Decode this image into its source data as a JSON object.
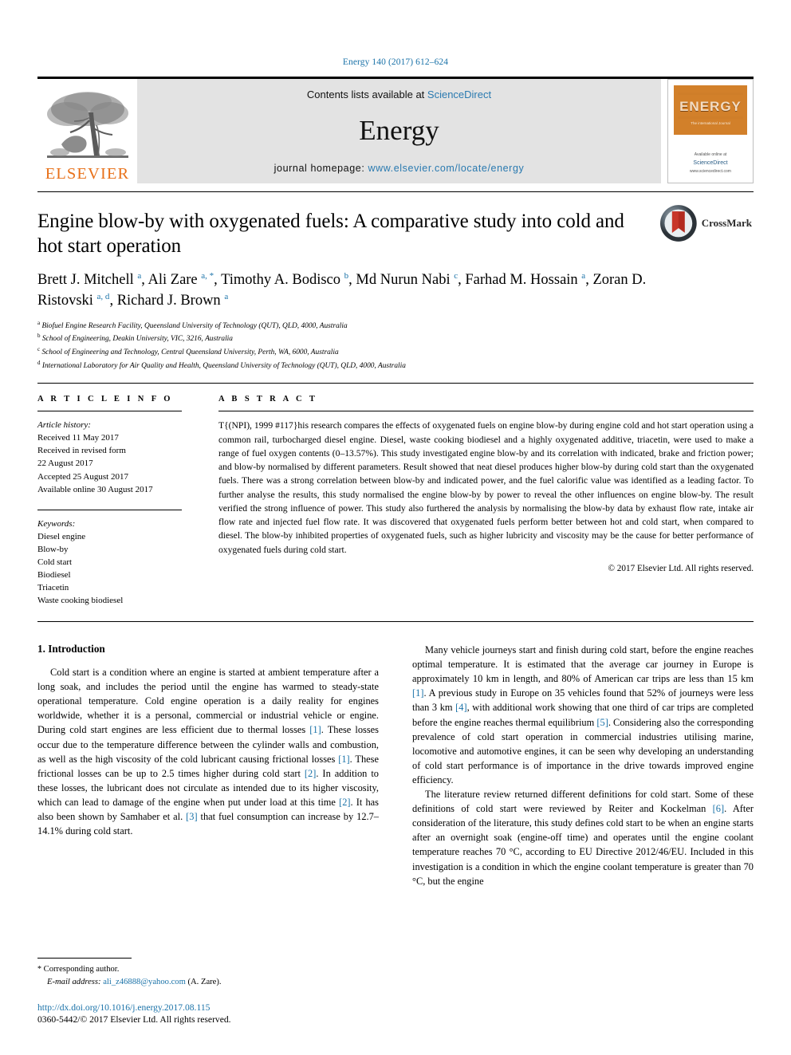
{
  "running_head": "Energy 140 (2017) 612–624",
  "masthead": {
    "publisher_name": "ELSEVIER",
    "contents_prefix": "Contents lists available at ",
    "contents_link": "ScienceDirect",
    "journal_name": "Energy",
    "homepage_label": "journal homepage: ",
    "homepage_url": "www.elsevier.com/locate/energy",
    "cover": {
      "title": "ENERGY",
      "subtitle": "The international Journal",
      "footer_line1": "Available online at",
      "footer_line2": "ScienceDirect",
      "footer_line3": "www.sciencedirect.com"
    }
  },
  "article": {
    "title": "Engine blow-by with oxygenated fuels: A comparative study into cold and hot start operation",
    "crossmark_label": "CrossMark",
    "authors": [
      {
        "name": "Brett J. Mitchell",
        "marks": "a"
      },
      {
        "name": "Ali Zare",
        "marks": "a, *"
      },
      {
        "name": "Timothy A. Bodisco",
        "marks": "b"
      },
      {
        "name": "Md Nurun Nabi",
        "marks": "c"
      },
      {
        "name": "Farhad M. Hossain",
        "marks": "a"
      },
      {
        "name": "Zoran D. Ristovski",
        "marks": "a, d"
      },
      {
        "name": "Richard J. Brown",
        "marks": "a"
      }
    ],
    "affiliations": [
      {
        "mark": "a",
        "text": "Biofuel Engine Research Facility, Queensland University of Technology (QUT), QLD, 4000, Australia"
      },
      {
        "mark": "b",
        "text": "School of Engineering, Deakin University, VIC, 3216, Australia"
      },
      {
        "mark": "c",
        "text": "School of Engineering and Technology, Central Queensland University, Perth, WA, 6000, Australia"
      },
      {
        "mark": "d",
        "text": "International Laboratory for Air Quality and Health, Queensland University of Technology (QUT), QLD, 4000, Australia"
      }
    ]
  },
  "article_info": {
    "heading": "A R T I C L E  I N F O",
    "history_label": "Article history:",
    "history": [
      "Received 11 May 2017",
      "Received in revised form",
      "22 August 2017",
      "Accepted 25 August 2017",
      "Available online 30 August 2017"
    ],
    "keywords_label": "Keywords:",
    "keywords": [
      "Diesel engine",
      "Blow-by",
      "Cold start",
      "Biodiesel",
      "Triacetin",
      "Waste cooking biodiesel"
    ]
  },
  "abstract": {
    "heading": "A B S T R A C T",
    "text": "T{(NPI), 1999 #117}his research compares the effects of oxygenated fuels on engine blow-by during engine cold and hot start operation using a common rail, turbocharged diesel engine. Diesel, waste cooking biodiesel and a highly oxygenated additive, triacetin, were used to make a range of fuel oxygen contents (0–13.57%). This study investigated engine blow-by and its correlation with indicated, brake and friction power; and blow-by normalised by different parameters. Result showed that neat diesel produces higher blow-by during cold start than the oxygenated fuels. There was a strong correlation between blow-by and indicated power, and the fuel calorific value was identified as a leading factor. To further analyse the results, this study normalised the engine blow-by by power to reveal the other influences on engine blow-by. The result verified the strong influence of power. This study also furthered the analysis by normalising the blow-by data by exhaust flow rate, intake air flow rate and injected fuel flow rate. It was discovered that oxygenated fuels perform better between hot and cold start, when compared to diesel. The blow-by inhibited properties of oxygenated fuels, such as higher lubricity and viscosity may be the cause for better performance of oxygenated fuels during cold start.",
    "copyright": "© 2017 Elsevier Ltd. All rights reserved."
  },
  "body": {
    "section_heading": "1. Introduction",
    "left_paragraphs": [
      "Cold start is a condition where an engine is started at ambient temperature after a long soak, and includes the period until the engine has warmed to steady-state operational temperature. Cold engine operation is a daily reality for engines worldwide, whether it is a personal, commercial or industrial vehicle or engine. During cold start engines are less efficient due to thermal losses [1]. These losses occur due to the temperature difference between the cylinder walls and combustion, as well as the high viscosity of the cold lubricant causing frictional losses [1]. These frictional losses can be up to 2.5 times higher during cold start [2]. In addition to these losses, the lubricant does not circulate as intended due to its higher viscosity, which can lead to damage of the engine when put under load at this time [2]. It has also been shown by Samhaber et al. [3] that fuel consumption can increase by 12.7–14.1% during cold start."
    ],
    "right_paragraphs": [
      "Many vehicle journeys start and finish during cold start, before the engine reaches optimal temperature. It is estimated that the average car journey in Europe is approximately 10 km in length, and 80% of American car trips are less than 15 km [1]. A previous study in Europe on 35 vehicles found that 52% of journeys were less than 3 km [4], with additional work showing that one third of car trips are completed before the engine reaches thermal equilibrium [5]. Considering also the corresponding prevalence of cold start operation in commercial industries utilising marine, locomotive and automotive engines, it can be seen why developing an understanding of cold start performance is of importance in the drive towards improved engine efficiency.",
      "The literature review returned different definitions for cold start. Some of these definitions of cold start were reviewed by Reiter and Kockelman [6]. After consideration of the literature, this study defines cold start to be when an engine starts after an overnight soak (engine-off time) and operates until the engine coolant temperature reaches 70 °C, according to EU Directive 2012/46/EU. Included in this investigation is a condition in which the engine coolant temperature is greater than 70 °C, but the engine"
    ]
  },
  "footer": {
    "corresponding_star": "*",
    "corresponding_label": "Corresponding author.",
    "email_label": "E-mail address:",
    "email": "ali_z46888@yahoo.com",
    "email_owner": "(A. Zare).",
    "doi": "http://dx.doi.org/10.1016/j.energy.2017.08.115",
    "issn_line": "0360-5442/© 2017 Elsevier Ltd. All rights reserved."
  },
  "colors": {
    "link": "#1a72a8",
    "elsevier_orange": "#E8711A",
    "banner_bg": "#e3e3e3"
  }
}
